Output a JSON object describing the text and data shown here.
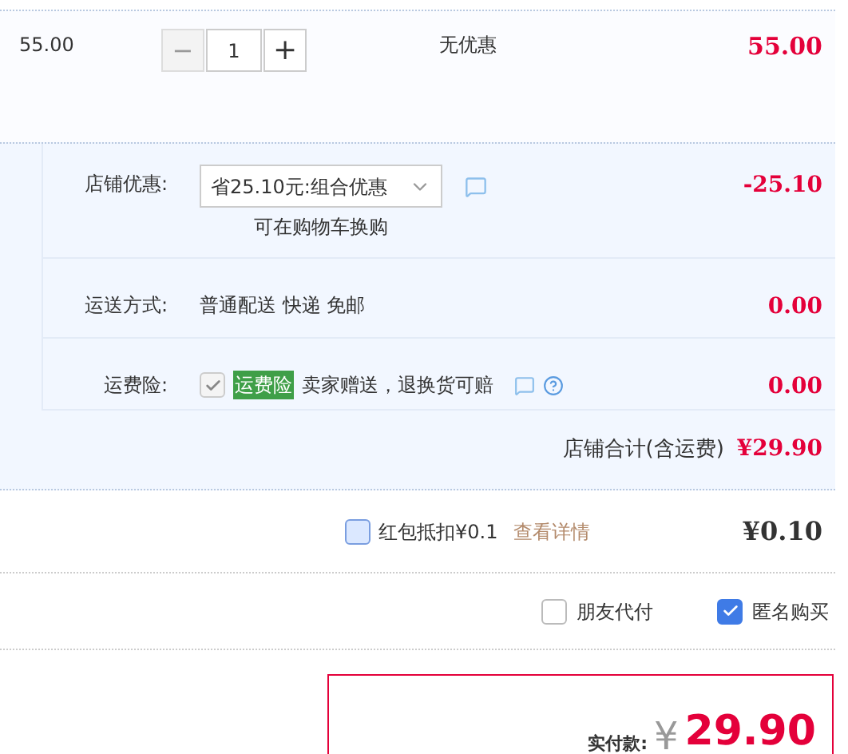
{
  "item": {
    "unit_price": "55.00",
    "quantity": "1",
    "minus": "−",
    "plus": "+",
    "minus_disabled": true,
    "discount": "无优惠",
    "subtotal": "55.00"
  },
  "shop": {
    "rows": [
      {
        "kind": "promo",
        "label": "店铺优惠:",
        "select": "省25.10元:组合优惠",
        "hint": "可在购物车换购",
        "amount": "-25.10"
      },
      {
        "kind": "text",
        "label": "运送方式:",
        "value": "普通配送 快递 免邮",
        "amount": "0.00"
      },
      {
        "kind": "insurance",
        "label": "运费险:",
        "checked": true,
        "disabled": true,
        "tag": "运费险",
        "value": "卖家赠送，退换货可赔",
        "amount": "0.00"
      }
    ],
    "total_label": "店铺合计(含运费)",
    "total": "¥29.90"
  },
  "red_packet": {
    "checked": false,
    "label": "红包抵扣¥0.1",
    "link": "查看详情",
    "amount": "¥0.10"
  },
  "options": [
    {
      "label": "朋友代付",
      "checked": false
    },
    {
      "label": "匿名购买",
      "checked": true
    }
  ],
  "pay": {
    "label": "实付款:",
    "currency": "¥",
    "amount": "29.90"
  }
}
